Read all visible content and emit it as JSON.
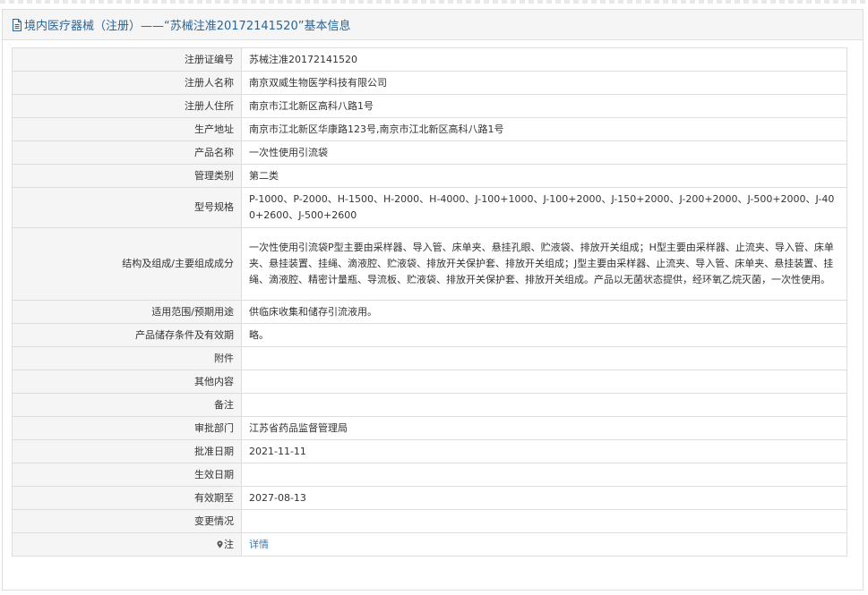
{
  "header": {
    "title": "境内医疗器械（注册）——“苏械注准20172141520”基本信息",
    "icon": "document-icon"
  },
  "rows": [
    {
      "label": "注册证编号",
      "value": "苏械注准20172141520"
    },
    {
      "label": "注册人名称",
      "value": "南京双威生物医学科技有限公司"
    },
    {
      "label": "注册人住所",
      "value": "南京市江北新区高科八路1号"
    },
    {
      "label": "生产地址",
      "value": "南京市江北新区华康路123号,南京市江北新区高科八路1号"
    },
    {
      "label": "产品名称",
      "value": "一次性使用引流袋"
    },
    {
      "label": "管理类别",
      "value": "第二类"
    },
    {
      "label": "型号规格",
      "value": "P-1000、P-2000、H-1500、H-2000、H-4000、J-100+1000、J-100+2000、J-150+2000、J-200+2000、J-500+2000、J-400+2600、J-500+2600"
    },
    {
      "label": "结构及组成/主要组成成分",
      "value": "一次性使用引流袋P型主要由采样器、导入管、床单夹、悬挂孔眼、贮液袋、排放开关组成；H型主要由采样器、止流夹、导入管、床单夹、悬挂装置、挂绳、滴液腔、贮液袋、排放开关保护套、排放开关组成；J型主要由采样器、止流夹、导入管、床单夹、悬挂装置、挂绳、滴液腔、精密计量瓶、导流板、贮液袋、排放开关保护套、排放开关组成。产品以无菌状态提供，经环氧乙烷灭菌，一次性使用。"
    },
    {
      "label": "适用范围/预期用途",
      "value": "供临床收集和储存引流液用。"
    },
    {
      "label": "产品储存条件及有效期",
      "value": "略。"
    },
    {
      "label": "附件",
      "value": ""
    },
    {
      "label": "其他内容",
      "value": ""
    },
    {
      "label": "备注",
      "value": ""
    },
    {
      "label": "审批部门",
      "value": "江苏省药品监督管理局"
    },
    {
      "label": "批准日期",
      "value": "2021-11-11"
    },
    {
      "label": "生效日期",
      "value": ""
    },
    {
      "label": "有效期至",
      "value": "2027-08-13"
    },
    {
      "label": "变更情况",
      "value": ""
    }
  ],
  "note_row": {
    "label": "注",
    "icon": "pin-icon",
    "link_text": "详情"
  },
  "colors": {
    "title": "#2a6496",
    "link": "#337ab7",
    "label_bg": "#f5f5f5",
    "border": "#dddddd"
  }
}
